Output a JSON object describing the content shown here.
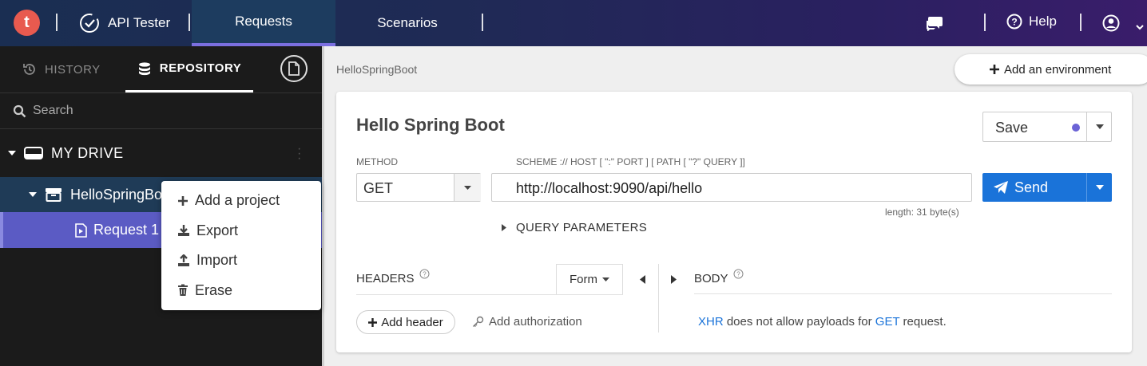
{
  "topbar": {
    "logo_letter": "t",
    "app_name": "API Tester",
    "tabs": [
      {
        "label": "Requests",
        "active": true
      },
      {
        "label": "Scenarios",
        "active": false
      }
    ],
    "help_label": "Help"
  },
  "sidebar": {
    "tab_history": "HISTORY",
    "tab_repository": "REPOSITORY",
    "search_placeholder": "Search",
    "drive_label": "MY DRIVE",
    "project_label": "HelloSpringBo",
    "request_label": "Request 1"
  },
  "context_menu": {
    "items": [
      {
        "label": "Add a project",
        "icon": "plus-icon"
      },
      {
        "label": "Export",
        "icon": "export-icon"
      },
      {
        "label": "Import",
        "icon": "import-icon"
      },
      {
        "label": "Erase",
        "icon": "trash-icon"
      }
    ]
  },
  "main": {
    "breadcrumb": "HelloSpringBoot",
    "add_environment": "Add an environment",
    "request_title": "Hello Spring Boot",
    "save_label": "Save",
    "method_label": "METHOD",
    "method_value": "GET",
    "url_label": "SCHEME :// HOST [ \":\" PORT ] [ PATH [ \"?\" QUERY ]]",
    "url_value": "http://localhost:9090/api/hello",
    "url_length": "length: 31 byte(s)",
    "send_label": "Send",
    "query_parameters": "QUERY PARAMETERS",
    "headers_label": "HEADERS",
    "form_label": "Form",
    "body_label": "BODY",
    "add_header": "Add header",
    "add_authorization": "Add authorization",
    "xhr_link": "XHR",
    "xhr_text": " does not allow payloads for ",
    "get_link": "GET",
    "xhr_end": " request."
  },
  "colors": {
    "accent": "#1a73d9",
    "selected_request": "#5b5bc4",
    "logo": "#e85a4f",
    "unsaved_dot": "#6b63d6"
  }
}
